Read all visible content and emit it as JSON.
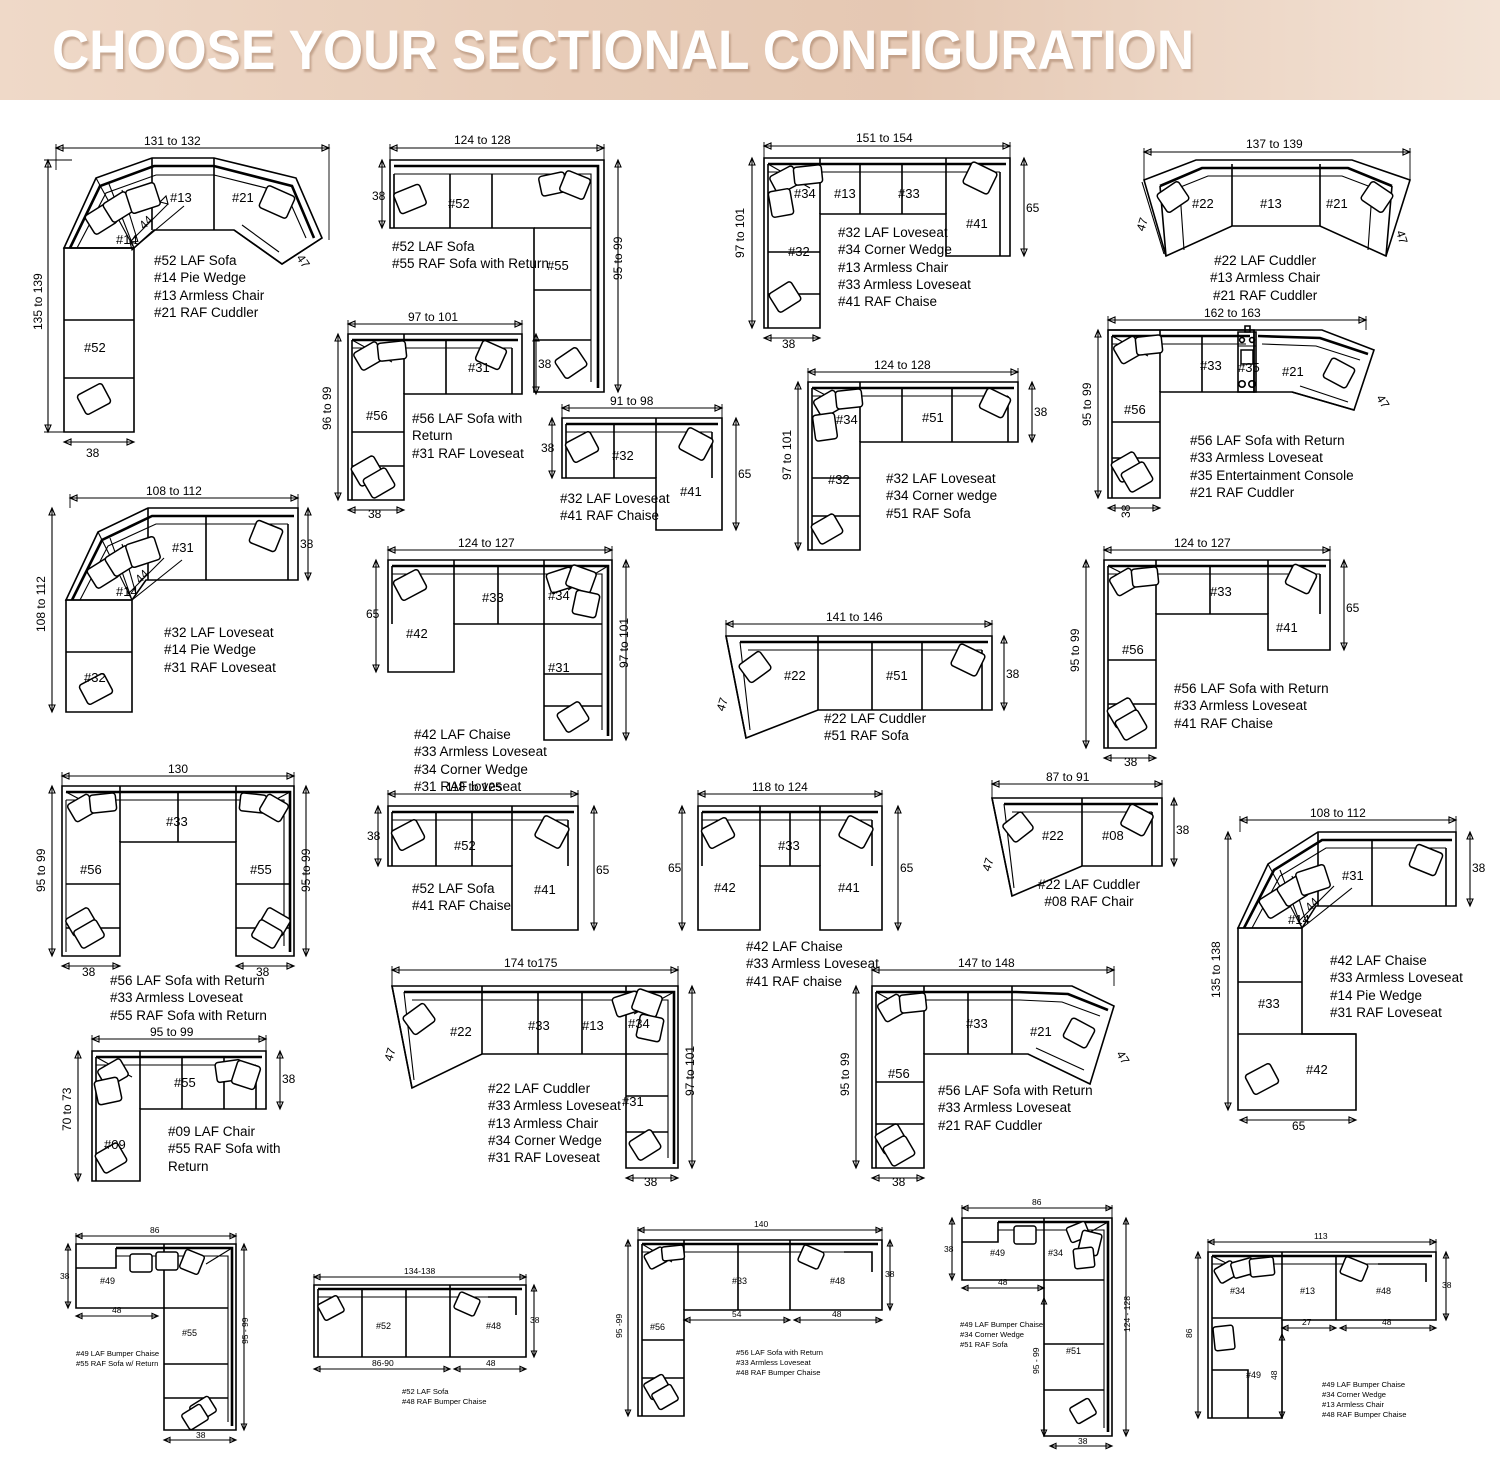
{
  "banner": {
    "title": "CHOOSE YOUR SECTIONAL CONFIGURATION",
    "bg_color_left": "#efd9c8",
    "bg_color_right": "#f3e3d6",
    "text_color": "#ffffff"
  },
  "page": {
    "background": "#ffffff",
    "line_color": "#000000",
    "total_configurations": 24,
    "units": "inches"
  },
  "configurations": [
    {
      "id": "cfg-01",
      "overall_width": "131 to 132",
      "overall_depth": "135 to 139",
      "side_depth": "38",
      "angle_dims": [
        "44",
        "47"
      ],
      "pieces": [
        {
          "code": "#52",
          "name": "LAF Sofa"
        },
        {
          "code": "#14",
          "name": "Pie Wedge"
        },
        {
          "code": "#13",
          "name": "Armless Chair"
        },
        {
          "code": "#21",
          "name": "RAF Cuddler"
        }
      ],
      "legend": "#52 LAF Sofa\n#14 Pie Wedge\n#13 Armless Chair\n#21 RAF Cuddler",
      "seat_labels": [
        "#13",
        "#21",
        "#14",
        "#52"
      ]
    },
    {
      "id": "cfg-02",
      "overall_width": "124 to 128",
      "overall_depth": "95 to 99",
      "side_depth": "38",
      "pieces": [
        {
          "code": "#52",
          "name": "LAF Sofa"
        },
        {
          "code": "#55",
          "name": "RAF Sofa with Return"
        }
      ],
      "legend": "#52 LAF Sofa\n#55 RAF Sofa with Return",
      "seat_labels": [
        "#52",
        "#55"
      ]
    },
    {
      "id": "cfg-03",
      "overall_width": "151 to 154",
      "overall_depth": "97 to 101",
      "side_depth": "38",
      "chaise_depth": "65",
      "pieces": [
        {
          "code": "#32",
          "name": "LAF Loveseat"
        },
        {
          "code": "#34",
          "name": "Corner Wedge"
        },
        {
          "code": "#13",
          "name": "Armless Chair"
        },
        {
          "code": "#33",
          "name": "Armless Loveseat"
        },
        {
          "code": "#41",
          "name": "RAF Chaise"
        }
      ],
      "legend": "#32 LAF Loveseat\n#34 Corner Wedge\n#13 Armless Chair\n#33 Armless Loveseat\n#41 RAF Chaise",
      "seat_labels": [
        "#34",
        "#13",
        "#33",
        "#41",
        "#32"
      ]
    },
    {
      "id": "cfg-04",
      "overall_width": "137 to 139",
      "angle_dims": [
        "47",
        "47"
      ],
      "pieces": [
        {
          "code": "#22",
          "name": "LAF Cuddler"
        },
        {
          "code": "#13",
          "name": "Armless Chair"
        },
        {
          "code": "#21",
          "name": "RAF Cuddler"
        }
      ],
      "legend": "#22 LAF Cuddler\n#13 Armless Chair\n#21 RAF Cuddler",
      "seat_labels": [
        "#22",
        "#13",
        "#21"
      ]
    },
    {
      "id": "cfg-05",
      "overall_width": "97 to 101",
      "overall_depth": "96 to 99",
      "side_depth": "38",
      "back_depth": "38",
      "pieces": [
        {
          "code": "#56",
          "name": "LAF Sofa with Return"
        },
        {
          "code": "#31",
          "name": "RAF Loveseat"
        }
      ],
      "legend": "#56 LAF Sofa with Return\n#31 RAF Loveseat",
      "seat_labels": [
        "#56",
        "#31"
      ]
    },
    {
      "id": "cfg-06",
      "overall_width": "162 to 163",
      "overall_depth": "95 to 99",
      "side_depth": "38",
      "angle_dims": [
        "47"
      ],
      "pieces": [
        {
          "code": "#56",
          "name": "LAF Sofa with Return"
        },
        {
          "code": "#33",
          "name": "Armless Loveseat"
        },
        {
          "code": "#35",
          "name": "Entertainment Console"
        },
        {
          "code": "#21",
          "name": "RAF Cuddler"
        }
      ],
      "legend": "#56 LAF Sofa with Return\n#33 Armless Loveseat\n#35 Entertainment Console\n#21 RAF Cuddler",
      "seat_labels": [
        "#33",
        "#35",
        "#21",
        "#56"
      ]
    },
    {
      "id": "cfg-07",
      "overall_width": "91 to 98",
      "back_depth": "38",
      "chaise_depth": "65",
      "pieces": [
        {
          "code": "#32",
          "name": "LAF Loveseat"
        },
        {
          "code": "#41",
          "name": "RAF Chaise"
        }
      ],
      "legend": "#32 LAF Loveseat\n#41 RAF Chaise",
      "seat_labels": [
        "#32",
        "#41"
      ]
    },
    {
      "id": "cfg-08",
      "overall_width": "124 to 128",
      "overall_depth": "97 to 101",
      "back_depth": "38",
      "pieces": [
        {
          "code": "#32",
          "name": "LAF Loveseat"
        },
        {
          "code": "#34",
          "name": "Corner wedge"
        },
        {
          "code": "#51",
          "name": "RAF Sofa"
        }
      ],
      "legend": "#32 LAF Loveseat\n#34 Corner wedge\n#51 RAF Sofa",
      "seat_labels": [
        "#34",
        "#51",
        "#32"
      ]
    },
    {
      "id": "cfg-09",
      "overall_width": "108 to 112",
      "overall_depth": "108 to 112",
      "back_depth": "38",
      "angle_dims": [
        "44"
      ],
      "pieces": [
        {
          "code": "#32",
          "name": "LAF Loveseat"
        },
        {
          "code": "#14",
          "name": "Pie Wedge"
        },
        {
          "code": "#31",
          "name": "RAF Loveseat"
        }
      ],
      "legend": "#32 LAF Loveseat\n#14 Pie Wedge\n#31 RAF Loveseat",
      "seat_labels": [
        "#31",
        "#14",
        "#32"
      ]
    },
    {
      "id": "cfg-10",
      "overall_width": "124 to 127",
      "overall_depth": "97 to 101",
      "chaise_depth": "65",
      "pieces": [
        {
          "code": "#42",
          "name": "LAF Chaise"
        },
        {
          "code": "#33",
          "name": "Armless Loveseat"
        },
        {
          "code": "#34",
          "name": "Corner Wedge"
        },
        {
          "code": "#31",
          "name": "RAF loveseat"
        }
      ],
      "legend": "#42 LAF Chaise\n#33 Armless Loveseat\n#34 Corner Wedge\n#31 RAF loveseat",
      "seat_labels": [
        "#42",
        "#33",
        "#34",
        "#31"
      ]
    },
    {
      "id": "cfg-11",
      "overall_width": "141 to 146",
      "back_depth": "38",
      "angle_dims": [
        "47"
      ],
      "pieces": [
        {
          "code": "#22",
          "name": "LAF Cuddler"
        },
        {
          "code": "#51",
          "name": "RAF Sofa"
        }
      ],
      "legend": "#22 LAF Cuddler\n#51 RAF Sofa",
      "seat_labels": [
        "#22",
        "#51"
      ]
    },
    {
      "id": "cfg-12",
      "overall_width": "124 to 127",
      "overall_depth": "95 to 99",
      "side_depth": "38",
      "chaise_depth": "65",
      "pieces": [
        {
          "code": "#56",
          "name": "LAF Sofa with Return"
        },
        {
          "code": "#33",
          "name": "Armless Loveseat"
        },
        {
          "code": "#41",
          "name": "RAF Chaise"
        }
      ],
      "legend": "#56 LAF Sofa with Return\n#33 Armless Loveseat\n#41 RAF Chaise",
      "seat_labels": [
        "#33",
        "#41",
        "#56"
      ]
    },
    {
      "id": "cfg-13",
      "overall_width": "130",
      "overall_depth_left": "95 to 99",
      "overall_depth_right": "95 to 99",
      "side_depth_left": "38",
      "side_depth_right": "38",
      "pieces": [
        {
          "code": "#56",
          "name": "LAF Sofa with Return"
        },
        {
          "code": "#33",
          "name": "Armless Loveseat"
        },
        {
          "code": "#55",
          "name": "RAF Sofa with Return"
        }
      ],
      "legend": "#56 LAF Sofa with Return\n#33 Armless Loveseat\n#55 RAF Sofa with Return",
      "seat_labels": [
        "#33",
        "#56",
        "#55"
      ]
    },
    {
      "id": "cfg-14",
      "overall_width": "118 to 125",
      "back_depth": "38",
      "chaise_depth": "65",
      "pieces": [
        {
          "code": "#52",
          "name": "LAF Sofa"
        },
        {
          "code": "#41",
          "name": "RAF Chaise"
        }
      ],
      "legend": "#52 LAF Sofa\n#41 RAF Chaise",
      "seat_labels": [
        "#52",
        "#41"
      ]
    },
    {
      "id": "cfg-15",
      "overall_width": "118 to 124",
      "left_depth": "65",
      "right_depth": "65",
      "pieces": [
        {
          "code": "#42",
          "name": "LAF Chaise"
        },
        {
          "code": "#33",
          "name": "Armless Loveseat"
        },
        {
          "code": "#41",
          "name": "RAF chaise"
        }
      ],
      "legend": "#42 LAF Chaise\n#33 Armless Loveseat\n#41 RAF chaise",
      "seat_labels": [
        "#42",
        "#33",
        "#41"
      ]
    },
    {
      "id": "cfg-16",
      "overall_width": "87 to 91",
      "back_depth": "38",
      "angle_dims": [
        "47"
      ],
      "pieces": [
        {
          "code": "#22",
          "name": "LAF Cuddler"
        },
        {
          "code": "#08",
          "name": "RAF Chair"
        }
      ],
      "legend": "#22 LAF Cuddler\n#08 RAF Chair",
      "seat_labels": [
        "#22",
        "#08"
      ]
    },
    {
      "id": "cfg-17",
      "overall_width": "108 to 112",
      "overall_depth": "135 to 138",
      "back_depth": "38",
      "chaise_width": "65",
      "angle_dims": [
        "44"
      ],
      "pieces": [
        {
          "code": "#42",
          "name": "LAF Chaise"
        },
        {
          "code": "#33",
          "name": "Armless Loveseat"
        },
        {
          "code": "#14",
          "name": "Pie Wedge"
        },
        {
          "code": "#31",
          "name": "RAF Loveseat"
        }
      ],
      "legend": "#42 LAF Chaise\n#33 Armless Loveseat\n#14 Pie Wedge\n#31 RAF Loveseat",
      "seat_labels": [
        "#31",
        "#14",
        "#33",
        "#42"
      ]
    },
    {
      "id": "cfg-18",
      "overall_width": "174 to175",
      "overall_depth": "97 to 101",
      "side_depth": "38",
      "angle_dims": [
        "47"
      ],
      "pieces": [
        {
          "code": "#22",
          "name": "LAF Cuddler"
        },
        {
          "code": "#33",
          "name": "Armless Loveseat"
        },
        {
          "code": "#13",
          "name": "Armless Chair"
        },
        {
          "code": "#34",
          "name": "Corner Wedge"
        },
        {
          "code": "#31",
          "name": "RAF Loveseat"
        }
      ],
      "legend": "#22 LAF Cuddler\n#33 Armless Loveseat\n#13 Armless Chair\n#34 Corner Wedge\n#31 RAF Loveseat",
      "seat_labels": [
        "#22",
        "#33",
        "#13",
        "#34",
        "#31"
      ]
    },
    {
      "id": "cfg-19",
      "overall_width": "147 to 148",
      "overall_depth": "95 to 99",
      "side_depth": "38",
      "angle_dims": [
        "47"
      ],
      "pieces": [
        {
          "code": "#56",
          "name": "LAF Sofa with Return"
        },
        {
          "code": "#33",
          "name": "Armless Loveseat"
        },
        {
          "code": "#21",
          "name": "RAF Cuddler"
        }
      ],
      "legend": "#56 LAF Sofa with Return\n#33 Armless Loveseat\n#21 RAF Cuddler",
      "seat_labels": [
        "#33",
        "#21",
        "#56"
      ]
    },
    {
      "id": "cfg-20",
      "overall_width": "95 to 99",
      "overall_depth": "70 to 73",
      "back_depth": "38",
      "pieces": [
        {
          "code": "#09",
          "name": "LAF Chair"
        },
        {
          "code": "#55",
          "name": "RAF Sofa with Return"
        }
      ],
      "legend": "#09 LAF Chair\n#55 RAF Sofa with Return",
      "seat_labels": [
        "#55",
        "#09"
      ]
    },
    {
      "id": "cfg-21",
      "overall_width": "86",
      "overall_depth": "95 - 99",
      "bumper_depth": "38",
      "bumper_width": "48",
      "side_depth": "38",
      "pieces": [
        {
          "code": "#49",
          "name": "LAF Bumper Chaise"
        },
        {
          "code": "#55",
          "name": "RAF Sofa w/ Return"
        }
      ],
      "legend": "#49 LAF Bumper Chaise\n#55 RAF Sofa w/ Return",
      "seat_labels": [
        "#49",
        "#55"
      ]
    },
    {
      "id": "cfg-22",
      "overall_width": "134-138",
      "sofa_width": "86-90",
      "bumper_width": "48",
      "back_depth": "38",
      "pieces": [
        {
          "code": "#52",
          "name": "LAF Sofa"
        },
        {
          "code": "#48",
          "name": "RAF Bumper Chaise"
        }
      ],
      "legend": "#52 LAF Sofa\n#48 RAF Bumper Chaise",
      "seat_labels": [
        "#52",
        "#48"
      ]
    },
    {
      "id": "cfg-23",
      "overall_width": "140",
      "overall_depth": "95 -99",
      "back_depth": "38",
      "left_width": "54",
      "right_width": "48",
      "pieces": [
        {
          "code": "#56",
          "name": "LAF Sofa with Return"
        },
        {
          "code": "#33",
          "name": "Armless Loveseat"
        },
        {
          "code": "#48",
          "name": "RAF Bumper Chaise"
        }
      ],
      "legend": "#56 LAF Sofa with Return\n#33 Armless Loveseat\n#48 RAF Bumper Chaise",
      "seat_labels": [
        "#56",
        "#33",
        "#48"
      ]
    },
    {
      "id": "cfg-24",
      "overall_width": "86",
      "overall_depth": "124 - 128",
      "inner_depth": "95 - 99",
      "bumper_depth": "38",
      "bumper_width": "48",
      "side_depth": "38",
      "pieces": [
        {
          "code": "#49",
          "name": "LAF Bumper Chaise"
        },
        {
          "code": "#34",
          "name": "Corner Wedge"
        },
        {
          "code": "#51",
          "name": "RAF Sofa"
        }
      ],
      "legend": "#49 LAF Bumper Chaise\n#34 Corner Wedge\n#51 RAF Sofa",
      "seat_labels": [
        "#49",
        "#34",
        "#51"
      ]
    },
    {
      "id": "cfg-25",
      "overall_width": "113",
      "overall_depth": "86",
      "back_depth": "38",
      "mid_width": "27",
      "right_width": "48",
      "bumper_depth": "48",
      "pieces": [
        {
          "code": "#49",
          "name": "LAF Bumper Chaise"
        },
        {
          "code": "#34",
          "name": "Corner Wedge"
        },
        {
          "code": "#13",
          "name": "Armless Chair"
        },
        {
          "code": "#48",
          "name": "RAF Bumper Chaise"
        }
      ],
      "legend": "#49 LAF Bumper Chaise\n#34 Corner Wedge\n#13 Armless Chair\n#48 RAF Bumper Chaise",
      "seat_labels": [
        "#34",
        "#13",
        "#48",
        "#49"
      ]
    }
  ]
}
